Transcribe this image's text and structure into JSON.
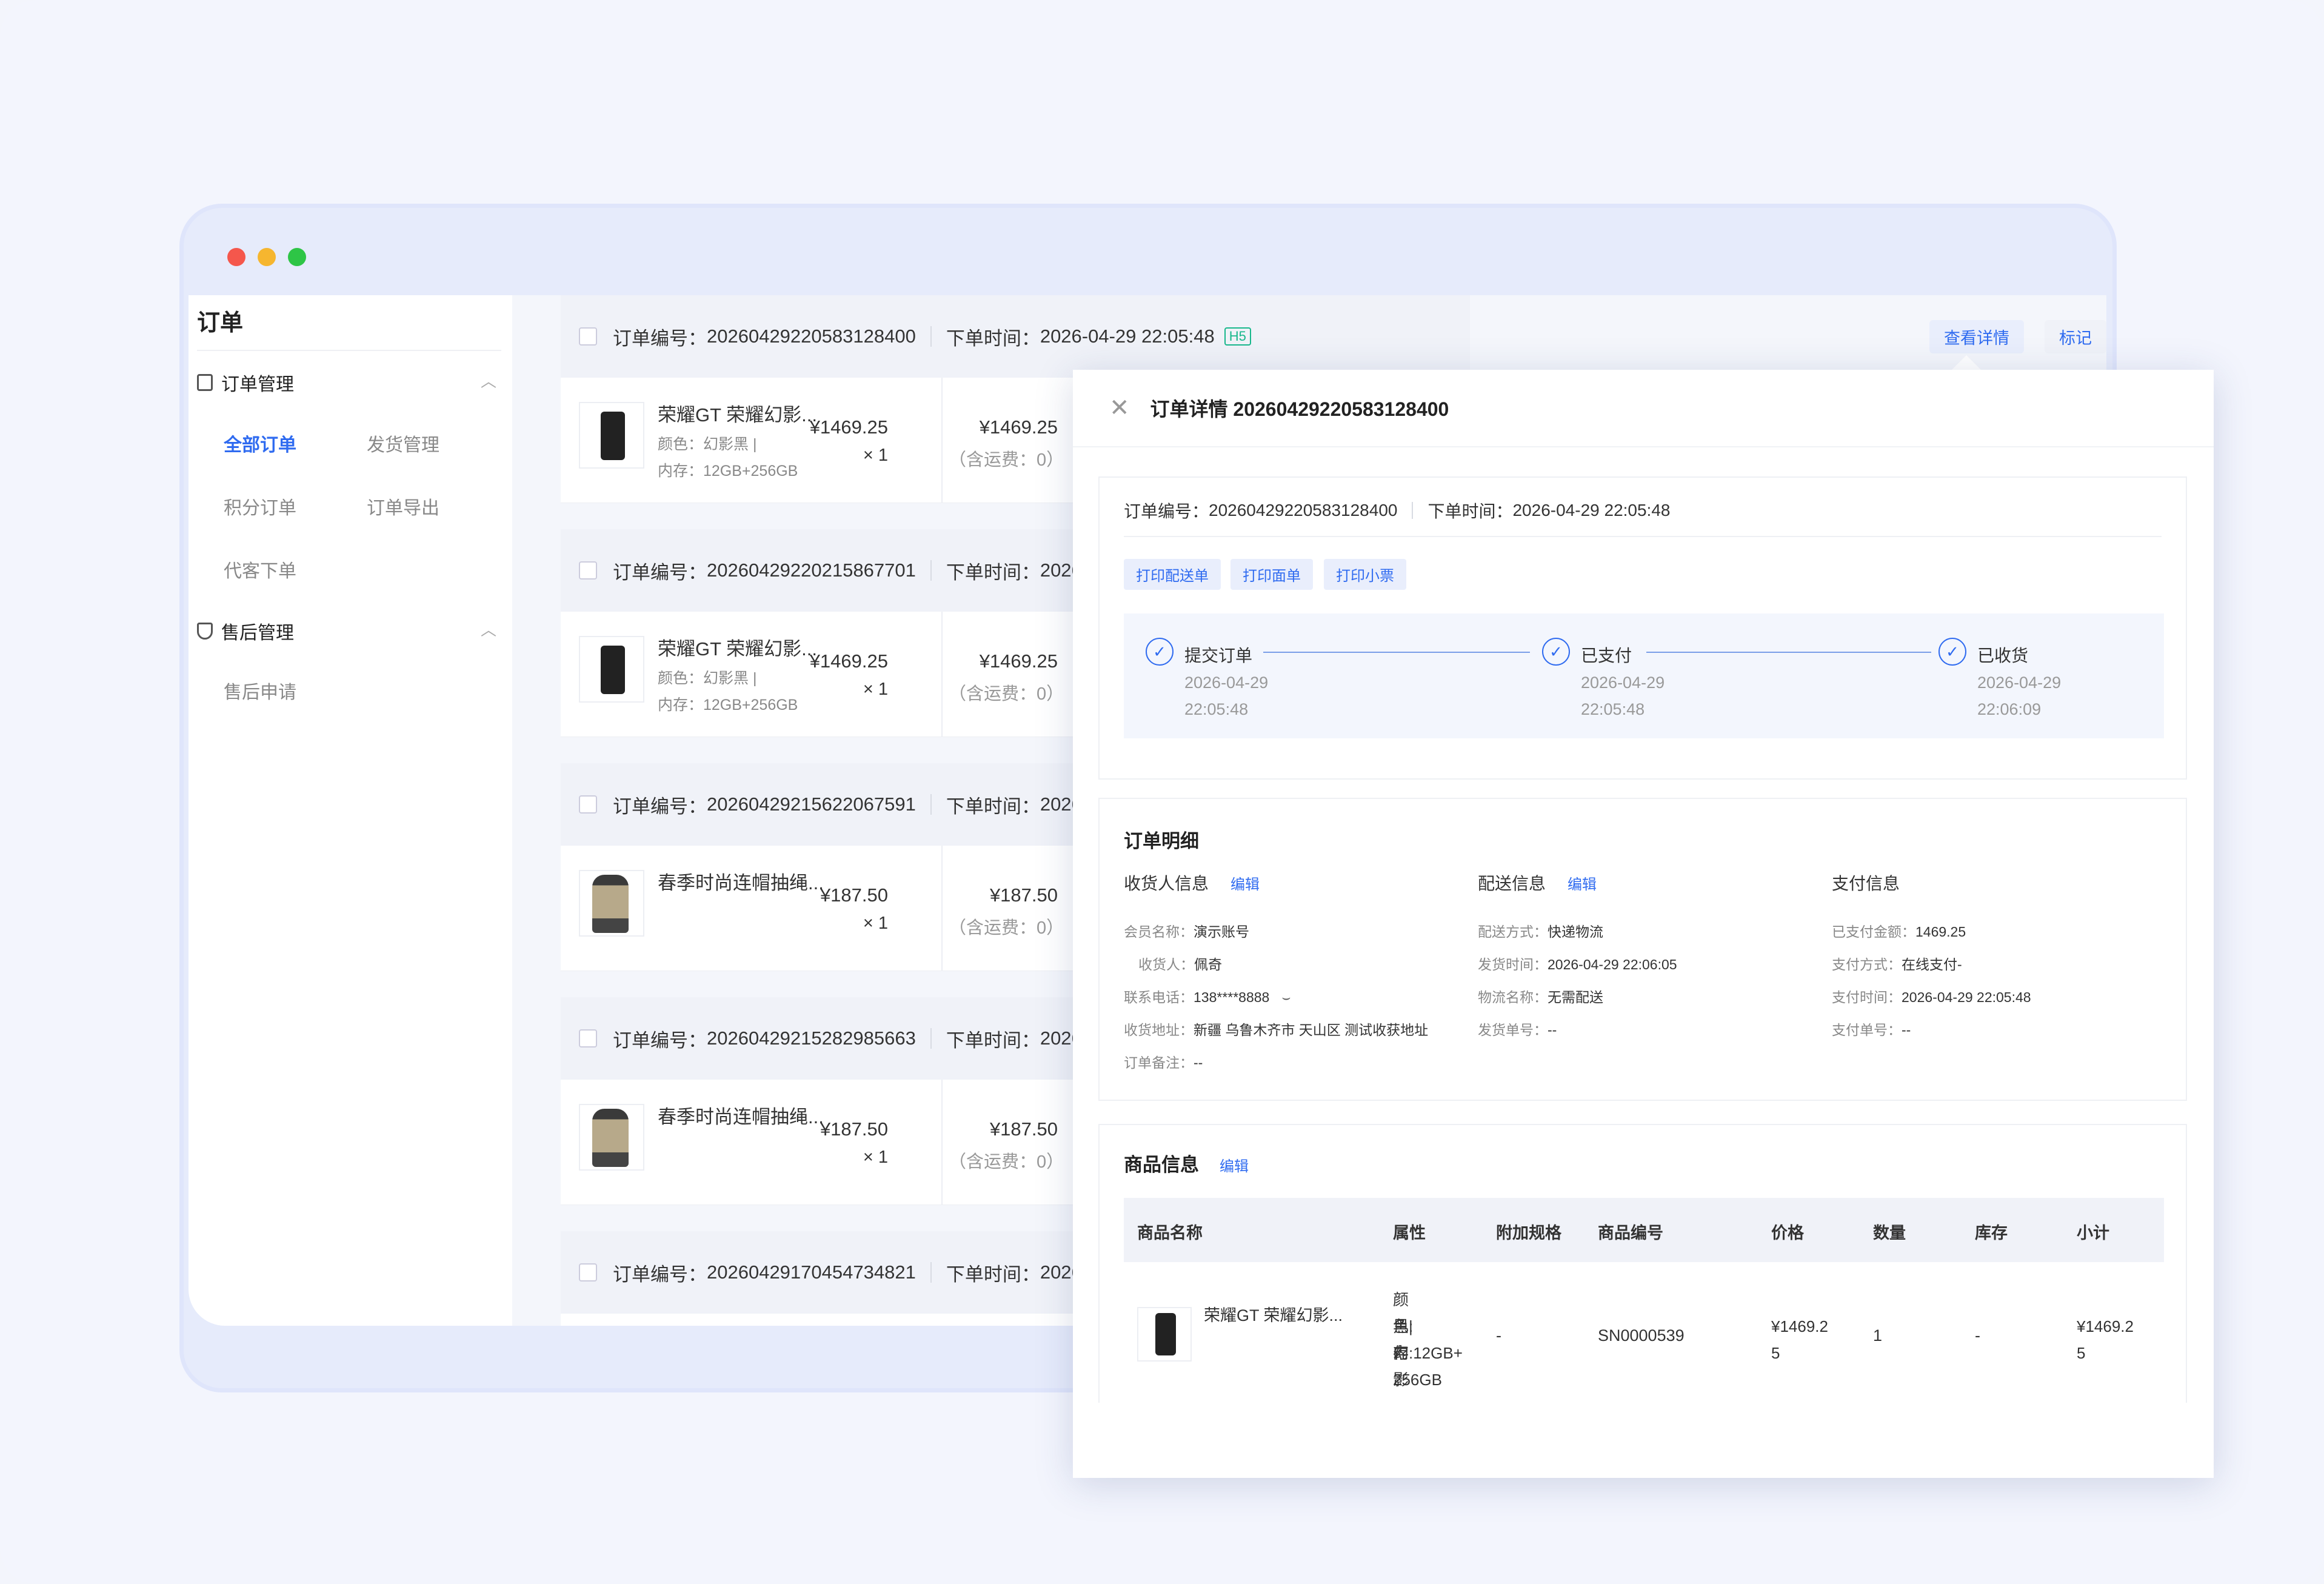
{
  "window_colors": {
    "red": "#f5574c",
    "yellow": "#f6b62f",
    "green": "#2ec546",
    "accent": "#2f6bf0"
  },
  "sidebar": {
    "title": "订单",
    "groups": [
      {
        "label": "订单管理",
        "icon": "clipboard-icon",
        "items": [
          "全部订单",
          "发货管理",
          "积分订单",
          "订单导出",
          "代客下单"
        ]
      },
      {
        "label": "售后管理",
        "icon": "shield-icon",
        "items": [
          "售后申请"
        ]
      }
    ]
  },
  "orders": [
    {
      "no_label": "订单编号：",
      "no": "20260429220583128400",
      "time_label": "下单时间：",
      "time": "2026-04-29 22:05:48",
      "tag": "H5",
      "product": "荣耀GT 荣耀幻影...",
      "attr1": "颜色：幻影黑 |",
      "attr2": "内存：12GB+256GB",
      "price": "¥1469.25",
      "qty": "× 1",
      "total": "¥1469.25",
      "shipping": "（含运费：0）"
    },
    {
      "no_label": "订单编号：",
      "no": "20260429220215867701",
      "time_label": "下单时间：",
      "time": "2026",
      "product": "荣耀GT 荣耀幻影...",
      "attr1": "颜色：幻影黑 |",
      "attr2": "内存：12GB+256GB",
      "price": "¥1469.25",
      "qty": "× 1",
      "total": "¥1469.25",
      "shipping": "（含运费：0）"
    },
    {
      "no_label": "订单编号：",
      "no": "20260429215622067591",
      "time_label": "下单时间：",
      "time": "2026",
      "product": "春季时尚连帽抽绳...",
      "price": "¥187.50",
      "qty": "× 1",
      "total": "¥187.50",
      "shipping": "（含运费：0）"
    },
    {
      "no_label": "订单编号：",
      "no": "20260429215282985663",
      "time_label": "下单时间：",
      "time": "2026",
      "product": "春季时尚连帽抽绳...",
      "price": "¥187.50",
      "qty": "× 1",
      "total": "¥187.50",
      "shipping": "（含运费：0）"
    },
    {
      "no_label": "订单编号：",
      "no": "20260429170454734821",
      "time_label": "下单时间：",
      "time": "2026"
    }
  ],
  "order_actions": {
    "detail": "查看详情",
    "mark": "标记"
  },
  "detail": {
    "title": "订单详情 20260429220583128400",
    "no_label": "订单编号：",
    "no": "20260429220583128400",
    "time_label": "下单时间：",
    "time": "2026-04-29 22:05:48",
    "print_buttons": [
      "打印配送单",
      "打印面单",
      "打印小票"
    ],
    "steps": [
      {
        "title": "提交订单",
        "date": "2026-04-29",
        "time": "22:05:48"
      },
      {
        "title": "已支付",
        "date": "2026-04-29",
        "time": "22:05:48"
      },
      {
        "title": "已收货",
        "date": "2026-04-29",
        "time": "22:06:09"
      }
    ],
    "order_detail": {
      "title": "订单明细",
      "edit": "编辑",
      "receiver": {
        "title": "收货人信息",
        "rows": [
          [
            "会员名称：",
            "演示账号"
          ],
          [
            "收货人：",
            "佩奇"
          ],
          [
            "联系电话：",
            "138****8888"
          ],
          [
            "收货地址：",
            "新疆 乌鲁木齐市 天山区 测试收获地址"
          ],
          [
            "订单备注：",
            "--"
          ]
        ]
      },
      "delivery": {
        "title": "配送信息",
        "rows": [
          [
            "配送方式：",
            "快递物流"
          ],
          [
            "发货时间：",
            "2026-04-29 22:06:05"
          ],
          [
            "物流名称：",
            "无需配送"
          ],
          [
            "发货单号：",
            "--"
          ]
        ]
      },
      "payment": {
        "title": "支付信息",
        "rows": [
          [
            "已支付金额：",
            "1469.25"
          ],
          [
            "支付方式：",
            "在线支付-"
          ],
          [
            "支付时间：",
            "2026-04-29 22:05:48"
          ],
          [
            "支付单号：",
            "--"
          ]
        ]
      }
    },
    "goods": {
      "title": "商品信息",
      "edit": "编辑",
      "columns": [
        "商品名称",
        "属性",
        "附加规格",
        "商品编号",
        "价格",
        "数量",
        "库存",
        "小计"
      ],
      "row": {
        "name": "荣耀GT 荣耀幻影...",
        "attr": [
          "颜色:幻影",
          "黑|内",
          "存:12GB+",
          "256GB"
        ],
        "extra": "-",
        "sku": "SN0000539",
        "price": [
          "¥1469.2",
          "5"
        ],
        "qty": "1",
        "stock": "-",
        "subtotal": [
          "¥1469.2",
          "5"
        ]
      }
    }
  }
}
